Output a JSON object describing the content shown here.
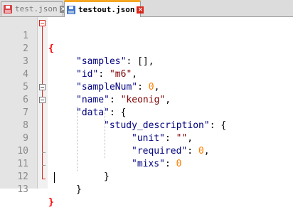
{
  "tabs": [
    {
      "label": "test.json",
      "active": false,
      "icon": "save-disk-icon-red"
    },
    {
      "label": "testout.json",
      "active": true,
      "icon": "save-disk-icon-blue"
    }
  ],
  "close_glyph": "×",
  "colors": {
    "keyword": "#000080",
    "string": "#800000",
    "number": "#ff8000",
    "brace_highlight": "#ff0000",
    "fold_active": "#d9261c",
    "active_tab_accent": "#f5a623"
  },
  "editor": {
    "line_numbers": [
      "1",
      "2",
      "3",
      "4",
      "5",
      "6",
      "7",
      "8",
      "9",
      "10",
      "11",
      "12",
      "13"
    ],
    "lines": {
      "l1": {
        "brace": "{"
      },
      "l2": {
        "key": "\"samples\"",
        "rest": ": [],"
      },
      "l3": {
        "key": "\"id\"",
        "colon": ": ",
        "value": "\"m6\"",
        "comma": ","
      },
      "l4": {
        "key": "\"sampleNum\"",
        "colon": ": ",
        "value": "0",
        "comma": ","
      },
      "l5": {
        "key": "\"name\"",
        "colon": ": ",
        "value": "\"keonig\"",
        "comma": ","
      },
      "l6": {
        "key": "\"data\"",
        "rest": ": {"
      },
      "l7": {
        "key": "\"study_description\"",
        "rest": ": {"
      },
      "l8": {
        "key": "\"unit\"",
        "colon": ": ",
        "value": "\"\"",
        "comma": ","
      },
      "l9": {
        "key": "\"required\"",
        "colon": ": ",
        "value": "0",
        "comma": ","
      },
      "l10": {
        "key": "\"mixs\"",
        "colon": ": ",
        "value": "0"
      },
      "l11": {
        "brace": "}"
      },
      "l12": {
        "brace": "}"
      },
      "l13": {
        "brace": "}"
      }
    }
  }
}
